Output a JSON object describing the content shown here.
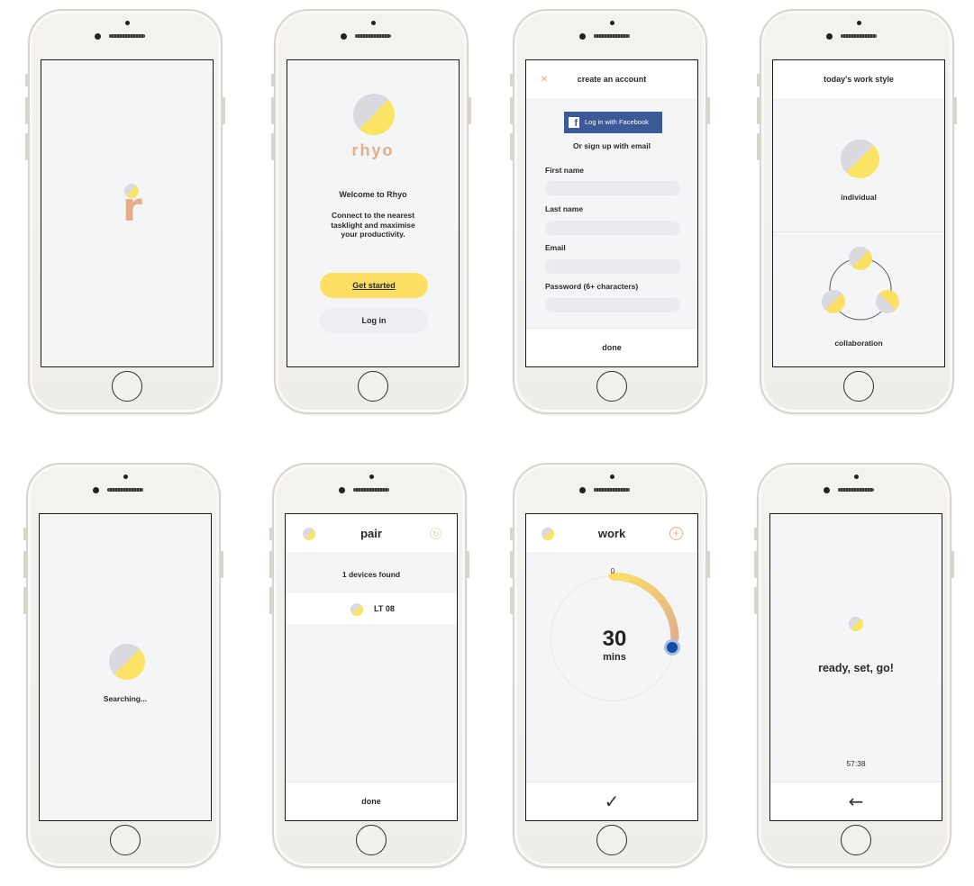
{
  "splash": {
    "letter": "r"
  },
  "welcome": {
    "brand": "rhyo",
    "title": "Welcome to Rhyo",
    "desc_lines": [
      "Connect to the nearest",
      "tasklight and maximise",
      "your productivity."
    ],
    "get_started": "Get started",
    "log_in": "Log in"
  },
  "signup": {
    "close_icon": "×",
    "title": "create an account",
    "facebook": "Log in with Facebook",
    "or_email": "Or sign up with email",
    "fields": [
      "First name",
      "Last name",
      "Email",
      "Password (6+ characters)"
    ],
    "done": "done"
  },
  "workstyle": {
    "title": "today's work style",
    "individual": "individual",
    "collaboration": "collaboration"
  },
  "searching": {
    "text": "Searching..."
  },
  "pair": {
    "title": "pair",
    "found": "1 devices found",
    "device": "LT 08",
    "done": "done"
  },
  "work": {
    "title": "work",
    "value": "30",
    "unit": "mins",
    "start": "0",
    "progress_fraction": 0.25,
    "confirm_icon": "✓"
  },
  "ready": {
    "text": "ready, set, go!",
    "timer": "57:38",
    "back_icon": "←"
  },
  "colors": {
    "yellow": "#fde063",
    "grey": "#d9d9df",
    "accent": "#e2ae8c",
    "facebook": "#3b5998",
    "knob": "#0d4fa3"
  }
}
